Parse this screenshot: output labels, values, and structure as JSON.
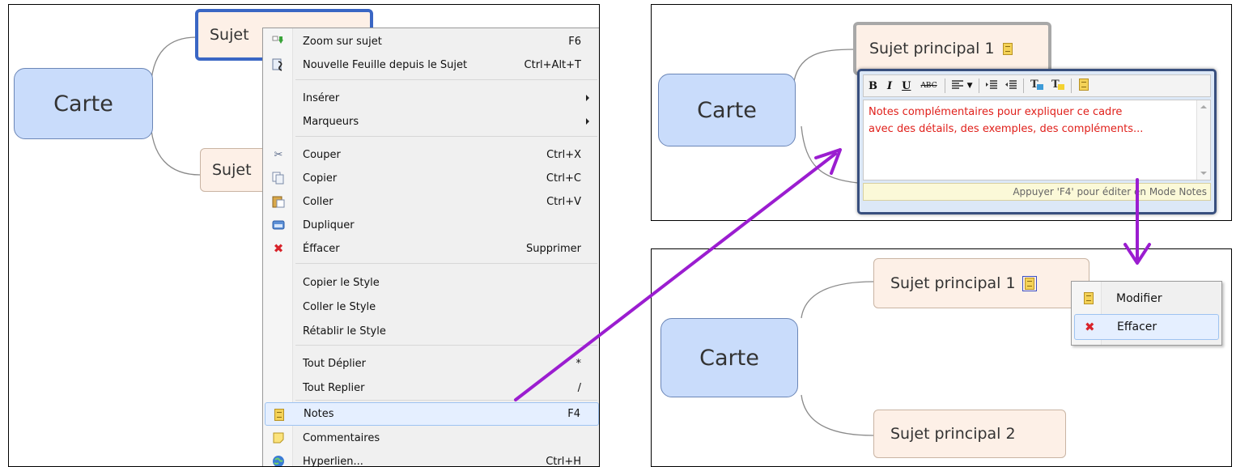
{
  "left_panel": {
    "central_label": "Carte",
    "topic1_label": "Sujet",
    "topic2_label": "Sujet"
  },
  "context_menu": {
    "items": [
      {
        "label": "Zoom sur sujet",
        "shortcut": "F6",
        "icon": "zoom-topic-icon"
      },
      {
        "label": "Nouvelle Feuille depuis le Sujet",
        "shortcut": "Ctrl+Alt+T",
        "icon": "new-sheet-icon"
      },
      {
        "label": "Insérer",
        "shortcut": "",
        "icon": ""
      },
      {
        "label": "Marqueurs",
        "shortcut": "",
        "icon": ""
      },
      {
        "label": "Couper",
        "shortcut": "Ctrl+X",
        "icon": "scissors-icon"
      },
      {
        "label": "Copier",
        "shortcut": "Ctrl+C",
        "icon": "copy-icon"
      },
      {
        "label": "Coller",
        "shortcut": "Ctrl+V",
        "icon": "paste-icon"
      },
      {
        "label": "Dupliquer",
        "shortcut": "",
        "icon": "duplicate-icon"
      },
      {
        "label": "Éffacer",
        "shortcut": "Supprimer",
        "icon": "delete-x-icon"
      },
      {
        "label": "Copier le Style",
        "shortcut": "",
        "icon": ""
      },
      {
        "label": "Coller le Style",
        "shortcut": "",
        "icon": ""
      },
      {
        "label": "Rétablir le Style",
        "shortcut": "",
        "icon": ""
      },
      {
        "label": "Tout Déplier",
        "shortcut": "*",
        "icon": ""
      },
      {
        "label": "Tout Replier",
        "shortcut": "/",
        "icon": ""
      },
      {
        "label": "Notes",
        "shortcut": "F4",
        "icon": "notes-icon"
      },
      {
        "label": "Commentaires",
        "shortcut": "",
        "icon": "comment-icon"
      },
      {
        "label": "Hyperlien...",
        "shortcut": "Ctrl+H",
        "icon": "globe-icon"
      }
    ]
  },
  "top_right": {
    "central_label": "Carte",
    "topic1_label": "Sujet principal  1",
    "editor": {
      "toolbar": [
        "B",
        "I",
        "U",
        "ABC"
      ],
      "text_line1": "Notes complémentaires pour expliquer ce cadre",
      "text_line2": "avec des détails, des exemples, des compléments...",
      "hint": "Appuyer 'F4' pour éditer en Mode Notes"
    }
  },
  "bottom_right": {
    "central_label": "Carte",
    "topic1_label": "Sujet principal  1",
    "topic2_label": "Sujet principal  2",
    "popup": {
      "modify_label": "Modifier",
      "delete_label": "Effacer"
    }
  },
  "colors": {
    "arrow": "#9b1dd0",
    "central_fill": "#c9dcfb",
    "topic_fill": "#fdf0e7",
    "note_text": "#e0201b",
    "selection": "#3a66c4"
  }
}
